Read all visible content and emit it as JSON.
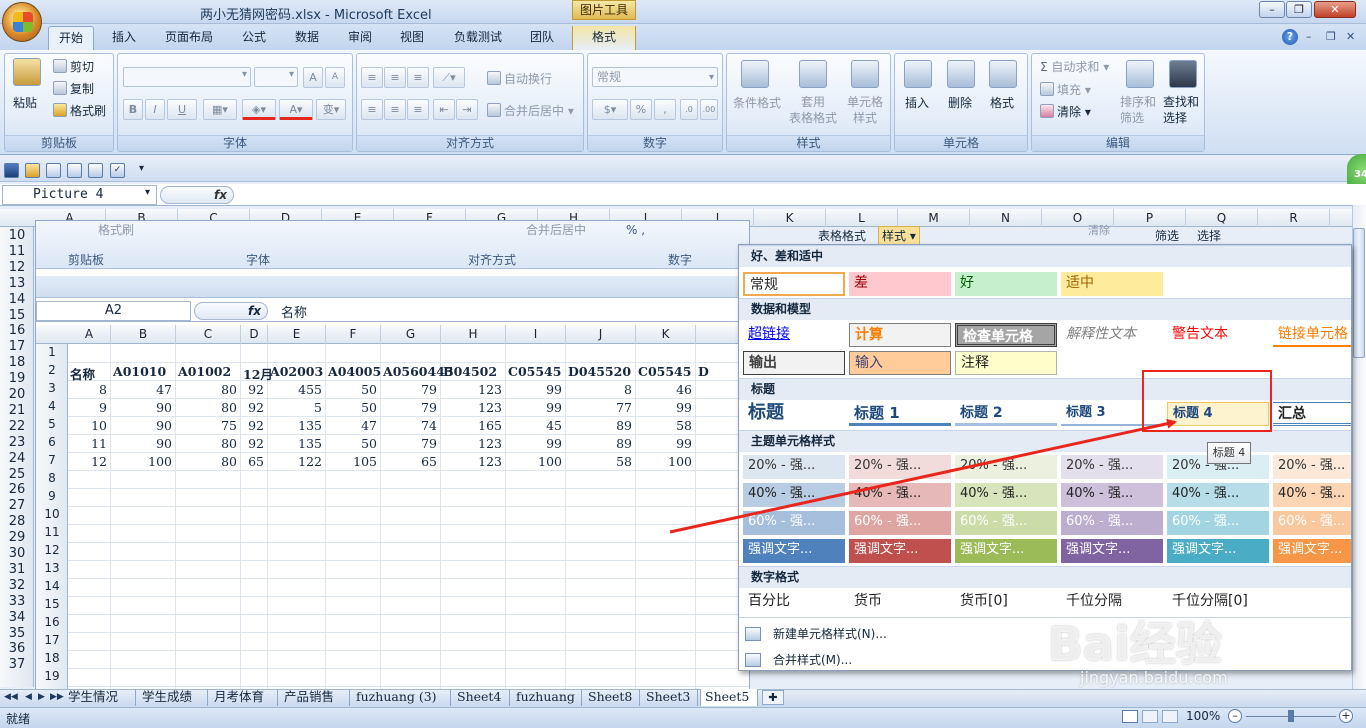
{
  "window": {
    "title": "两小无猜网密码.xlsx - Microsoft Excel",
    "context_tab_group": "图片工具",
    "controls": {
      "minimize": "–",
      "maximize": "❐",
      "close": "✕"
    }
  },
  "tabs": [
    "开始",
    "插入",
    "页面布局",
    "公式",
    "数据",
    "审阅",
    "视图",
    "负载测试",
    "团队",
    "格式"
  ],
  "ribbon": {
    "clipboard": {
      "paste": "粘贴",
      "cut": "剪切",
      "copy": "复制",
      "format_painter": "格式刷",
      "label": "剪贴板"
    },
    "font": {
      "label": "字体",
      "grow": "A",
      "shrink": "A",
      "bold": "B",
      "italic": "I",
      "underline": "U"
    },
    "alignment": {
      "wrap": "自动换行",
      "merge": "合并后居中",
      "label": "对齐方式"
    },
    "number": {
      "format": "常规",
      "percent": "%",
      "label": "数字"
    },
    "styles": {
      "cond": "条件格式",
      "table": "套用\n表格格式",
      "cell": "单元格\n样式",
      "label": "样式"
    },
    "cells": {
      "insert": "插入",
      "delete": "删除",
      "format": "格式",
      "label": "单元格"
    },
    "editing": {
      "autosum": "自动求和",
      "fill": "填充",
      "clear": "清除",
      "sort": "排序和\n筛选",
      "find": "查找和\n选择",
      "label": "编辑"
    }
  },
  "namebox": "Picture 4",
  "fx": "fx",
  "columns": [
    "A",
    "B",
    "C",
    "D",
    "E",
    "F",
    "G",
    "H",
    "I",
    "J",
    "K",
    "L",
    "M",
    "N",
    "O",
    "P",
    "Q",
    "R"
  ],
  "rows": [
    "10",
    "11",
    "12",
    "13",
    "14",
    "15",
    "16",
    "17",
    "18",
    "19",
    "20",
    "21",
    "22",
    "23",
    "24",
    "25",
    "26",
    "27",
    "28",
    "29",
    "30",
    "31",
    "32",
    "33",
    "34",
    "35",
    "36",
    "37"
  ],
  "picture": {
    "ribbon_fragment": {
      "format_painter": "格式刷",
      "clipboard": "剪贴板",
      "font": "字体",
      "alignment": "对齐方式",
      "number": "数字",
      "merge": "合并后居中",
      "table_format": "表格格式",
      "style": "样式",
      "clear": "清除",
      "filter": "筛选",
      "select": "选择"
    },
    "namebox": "A2",
    "fx": "fx",
    "formula": "名称",
    "columns": [
      "A",
      "B",
      "C",
      "D",
      "E",
      "F",
      "G",
      "H",
      "I",
      "J",
      "K"
    ],
    "rows": [
      "1",
      "2",
      "3",
      "4",
      "5",
      "6",
      "7",
      "8",
      "9",
      "10",
      "11",
      "12",
      "13",
      "14",
      "15",
      "16",
      "17",
      "18",
      "19"
    ],
    "table": {
      "headers": [
        "名称",
        "A01010",
        "A01002",
        "12月",
        "A02003",
        "A04005",
        "A0560445",
        "B04502",
        "C05545",
        "D045520",
        "C05545",
        "D"
      ],
      "data": [
        [
          "8",
          "47",
          "80",
          "92",
          "455",
          "50",
          "79",
          "123",
          "99",
          "8",
          "46"
        ],
        [
          "9",
          "90",
          "80",
          "92",
          "5",
          "50",
          "79",
          "123",
          "99",
          "77",
          "99"
        ],
        [
          "10",
          "90",
          "75",
          "92",
          "135",
          "47",
          "74",
          "165",
          "45",
          "89",
          "58"
        ],
        [
          "11",
          "90",
          "80",
          "92",
          "135",
          "50",
          "79",
          "123",
          "99",
          "89",
          "99"
        ],
        [
          "12",
          "100",
          "80",
          "65",
          "122",
          "105",
          "65",
          "123",
          "100",
          "58",
          "100"
        ]
      ]
    }
  },
  "gallery": {
    "sections": [
      "好、差和适中",
      "数据和模型",
      "标题",
      "主题单元格样式",
      "数字格式"
    ],
    "good_bad": [
      "常规",
      "差",
      "好",
      "适中"
    ],
    "data_model": [
      "超链接",
      "计算",
      "检查单元格",
      "解释性文本",
      "警告文本",
      "链接单元格",
      "输出",
      "输入",
      "注释"
    ],
    "titles": [
      "标题",
      "标题 1",
      "标题 2",
      "标题 3",
      "标题 4",
      "汇总"
    ],
    "accent_20": [
      "20% - 强...",
      "20% - 强...",
      "20% - 强...",
      "20% - 强...",
      "20% - 强...",
      "20% - 强..."
    ],
    "accent_40": [
      "40% - 强...",
      "40% - 强...",
      "40% - 强...",
      "40% - 强...",
      "40% - 强...",
      "40% - 强..."
    ],
    "accent_60": [
      "60% - 强...",
      "60% - 强...",
      "60% - 强...",
      "60% - 强...",
      "60% - 强...",
      "60% - 强..."
    ],
    "accent": [
      "强调文字...",
      "强调文字...",
      "强调文字...",
      "强调文字...",
      "强调文字...",
      "强调文字..."
    ],
    "number_formats": [
      "百分比",
      "货币",
      "货币[0]",
      "千位分隔",
      "千位分隔[0]"
    ],
    "new_style": "新建单元格样式(N)...",
    "merge_styles": "合并样式(M)...",
    "tooltip": "标题 4"
  },
  "sheets": [
    "学生情况",
    "学生成绩",
    "月考体育",
    "产品销售",
    "fuzhuang (3)",
    "Sheet4",
    "fuzhuang",
    "Sheet8",
    "Sheet3",
    "Sheet5"
  ],
  "status": {
    "ready": "就绪",
    "zoom": "100%"
  },
  "badge": "34",
  "watermark": {
    "brand": "Bai经验",
    "url": "jingyan.baidu.com"
  },
  "colors": {
    "accent1": "#4f81bd",
    "accent2": "#c0504d",
    "accent3": "#9bbb59",
    "accent4": "#8064a2",
    "accent5": "#4bacc6",
    "accent6": "#f79646",
    "highlight": "#e8261e"
  }
}
